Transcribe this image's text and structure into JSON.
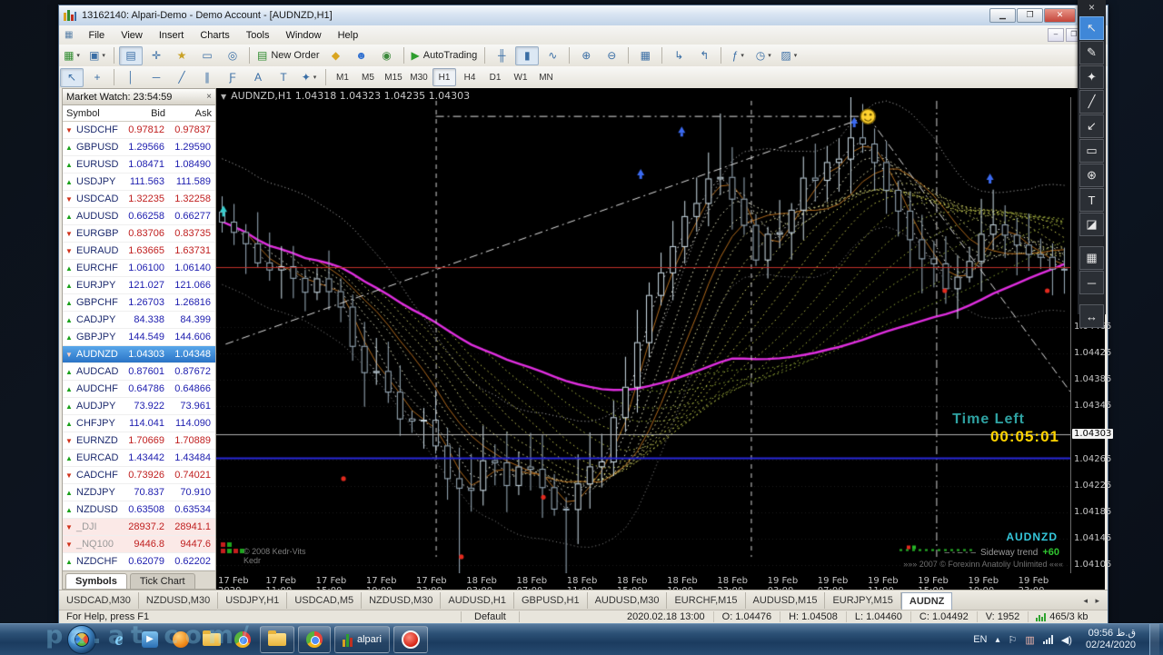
{
  "window": {
    "title": "13162140: Alpari-Demo - Demo Account - [AUDNZD,H1]",
    "menu": [
      "File",
      "View",
      "Insert",
      "Charts",
      "Tools",
      "Window",
      "Help"
    ]
  },
  "toolbar_row1": [
    {
      "name": "new-chart",
      "glyph": "▦",
      "dropdown": true,
      "accent": "#2e8b2e"
    },
    {
      "name": "profiles",
      "glyph": "▣",
      "dropdown": true
    },
    {
      "sep": true
    },
    {
      "name": "market-watch-toggle",
      "glyph": "▤",
      "pressed": true
    },
    {
      "name": "data-window",
      "glyph": "✛"
    },
    {
      "name": "navigator",
      "glyph": "★",
      "accent": "#c9a227"
    },
    {
      "name": "terminal",
      "glyph": "▭"
    },
    {
      "name": "strategy-tester",
      "glyph": "◎"
    },
    {
      "sep": true
    },
    {
      "name": "new-order",
      "glyph": "▤",
      "label": "New Order",
      "accent": "#2e8b2e"
    },
    {
      "name": "mql-editor",
      "glyph": "◆",
      "accent": "#d9a520"
    },
    {
      "name": "community",
      "glyph": "☻",
      "accent": "#2f6fd0"
    },
    {
      "name": "broadcast",
      "glyph": "◉",
      "accent": "#3c8a3c"
    },
    {
      "sep": true
    },
    {
      "name": "autotrading",
      "glyph": "▶",
      "label": "AutoTrading",
      "accent": "#2e9e2e"
    },
    {
      "sep": true
    },
    {
      "name": "bar-chart-mode",
      "glyph": "╫"
    },
    {
      "name": "candlestick-mode",
      "glyph": "▮",
      "pressed": true
    },
    {
      "name": "line-chart-mode",
      "glyph": "∿"
    },
    {
      "sep": true
    },
    {
      "name": "zoom-in",
      "glyph": "⊕"
    },
    {
      "name": "zoom-out",
      "glyph": "⊖"
    },
    {
      "sep": true
    },
    {
      "name": "tile-windows",
      "glyph": "▦"
    },
    {
      "sep": true
    },
    {
      "name": "auto-scroll",
      "glyph": "↳"
    },
    {
      "name": "chart-shift",
      "glyph": "↰"
    },
    {
      "sep": true
    },
    {
      "name": "indicators-list",
      "glyph": "ƒ",
      "dropdown": true
    },
    {
      "name": "periods-list",
      "glyph": "◷",
      "dropdown": true
    },
    {
      "name": "templates",
      "glyph": "▨",
      "dropdown": true
    }
  ],
  "toolbar_row2": [
    {
      "name": "cursor",
      "glyph": "↖",
      "pressed": true
    },
    {
      "name": "crosshair",
      "glyph": "+"
    },
    {
      "sep": true
    },
    {
      "name": "vertical-line",
      "glyph": "│"
    },
    {
      "name": "horizontal-line",
      "glyph": "─"
    },
    {
      "name": "trendline",
      "glyph": "╱"
    },
    {
      "name": "equidistant-channel",
      "glyph": "∥"
    },
    {
      "name": "fibonacci",
      "glyph": "Ƒ"
    },
    {
      "name": "text",
      "glyph": "A"
    },
    {
      "name": "text-label",
      "glyph": "T"
    },
    {
      "name": "arrows-tool",
      "glyph": "✦",
      "dropdown": true
    }
  ],
  "timeframes": {
    "items": [
      "M1",
      "M5",
      "M15",
      "M30",
      "H1",
      "H4",
      "D1",
      "W1",
      "MN"
    ],
    "active": "H1"
  },
  "market_watch": {
    "title": "Market Watch: 23:54:59",
    "columns": [
      "Symbol",
      "Bid",
      "Ask"
    ],
    "rows": [
      {
        "symbol": "USDCHF",
        "bid": "0.97812",
        "ask": "0.97837",
        "dir": "down"
      },
      {
        "symbol": "GBPUSD",
        "bid": "1.29566",
        "ask": "1.29590",
        "dir": "up"
      },
      {
        "symbol": "EURUSD",
        "bid": "1.08471",
        "ask": "1.08490",
        "dir": "up"
      },
      {
        "symbol": "USDJPY",
        "bid": "111.563",
        "ask": "111.589",
        "dir": "up"
      },
      {
        "symbol": "USDCAD",
        "bid": "1.32235",
        "ask": "1.32258",
        "dir": "down"
      },
      {
        "symbol": "AUDUSD",
        "bid": "0.66258",
        "ask": "0.66277",
        "dir": "up"
      },
      {
        "symbol": "EURGBP",
        "bid": "0.83706",
        "ask": "0.83735",
        "dir": "down"
      },
      {
        "symbol": "EURAUD",
        "bid": "1.63665",
        "ask": "1.63731",
        "dir": "down"
      },
      {
        "symbol": "EURCHF",
        "bid": "1.06100",
        "ask": "1.06140",
        "dir": "up"
      },
      {
        "symbol": "EURJPY",
        "bid": "121.027",
        "ask": "121.066",
        "dir": "up"
      },
      {
        "symbol": "GBPCHF",
        "bid": "1.26703",
        "ask": "1.26816",
        "dir": "up"
      },
      {
        "symbol": "CADJPY",
        "bid": "84.338",
        "ask": "84.399",
        "dir": "up"
      },
      {
        "symbol": "GBPJPY",
        "bid": "144.549",
        "ask": "144.606",
        "dir": "up"
      },
      {
        "symbol": "AUDNZD",
        "bid": "1.04303",
        "ask": "1.04348",
        "dir": "down",
        "selected": true
      },
      {
        "symbol": "AUDCAD",
        "bid": "0.87601",
        "ask": "0.87672",
        "dir": "up"
      },
      {
        "symbol": "AUDCHF",
        "bid": "0.64786",
        "ask": "0.64866",
        "dir": "up"
      },
      {
        "symbol": "AUDJPY",
        "bid": "73.922",
        "ask": "73.961",
        "dir": "up"
      },
      {
        "symbol": "CHFJPY",
        "bid": "114.041",
        "ask": "114.090",
        "dir": "up"
      },
      {
        "symbol": "EURNZD",
        "bid": "1.70669",
        "ask": "1.70889",
        "dir": "down"
      },
      {
        "symbol": "EURCAD",
        "bid": "1.43442",
        "ask": "1.43484",
        "dir": "up"
      },
      {
        "symbol": "CADCHF",
        "bid": "0.73926",
        "ask": "0.74021",
        "dir": "down"
      },
      {
        "symbol": "NZDJPY",
        "bid": "70.837",
        "ask": "70.910",
        "dir": "up"
      },
      {
        "symbol": "NZDUSD",
        "bid": "0.63508",
        "ask": "0.63534",
        "dir": "up"
      },
      {
        "symbol": "_DJI",
        "bid": "28937.2",
        "ask": "28941.1",
        "dir": "down",
        "index": true
      },
      {
        "symbol": "_NQ100",
        "bid": "9446.8",
        "ask": "9447.6",
        "dir": "down",
        "index": true
      },
      {
        "symbol": "NZDCHF",
        "bid": "0.62079",
        "ask": "0.62202",
        "dir": "up"
      }
    ],
    "tabs": [
      "Symbols",
      "Tick Chart"
    ],
    "active_tab": "Symbols"
  },
  "chart": {
    "info": "AUDNZD,H1  1.04318 1.04323 1.04235 1.04303",
    "time_left_label": "Time Left",
    "time_left_value": "00:05:01",
    "symbol_badge": "AUDNZD",
    "trend_prefix": "– - – - –",
    "trend_label": "Sideway trend",
    "trend_value": "+60",
    "copyright": "»»»   2007 © Forexinn Anatoliy Unlimited   «««",
    "watermark_line1": "© 2008 Kedr-Vits",
    "watermark_line2": "Kedr",
    "current_price": "1.04303",
    "price_labels": [
      "1.04465",
      "1.04425",
      "1.04385",
      "1.04345",
      "1.04265",
      "1.04225",
      "1.04185",
      "1.04145",
      "1.04105"
    ],
    "date_labels": [
      "17 Feb 2020",
      "17 Feb 11:00",
      "17 Feb 15:00",
      "17 Feb 19:00",
      "17 Feb 23:00",
      "18 Feb 03:00",
      "18 Feb 07:00",
      "18 Feb 11:00",
      "18 Feb 15:00",
      "18 Feb 19:00",
      "18 Feb 23:00",
      "19 Feb 03:00",
      "19 Feb 07:00",
      "19 Feb 11:00",
      "19 Feb 15:00",
      "19 Feb 19:00",
      "19 Feb 23:00"
    ]
  },
  "chart_data": {
    "type": "candlestick",
    "symbol": "AUDNZD",
    "timeframe": "H1",
    "ylim": [
      1.04093,
      1.04812
    ],
    "bars": 72,
    "price_path": [
      [
        0,
        1.0462
      ],
      [
        0.03,
        1.04585
      ],
      [
        0.06,
        1.04555
      ],
      [
        0.09,
        1.04535
      ],
      [
        0.12,
        1.04521
      ],
      [
        0.145,
        1.04504
      ],
      [
        0.16,
        1.04381
      ],
      [
        0.18,
        1.04408
      ],
      [
        0.21,
        1.04333
      ],
      [
        0.24,
        1.04312
      ],
      [
        0.27,
        1.04244
      ],
      [
        0.29,
        1.04196
      ],
      [
        0.31,
        1.04264
      ],
      [
        0.34,
        1.0423
      ],
      [
        0.36,
        1.04264
      ],
      [
        0.39,
        1.04209
      ],
      [
        0.41,
        1.04189
      ],
      [
        0.43,
        1.0423
      ],
      [
        0.455,
        1.04285
      ],
      [
        0.48,
        1.04381
      ],
      [
        0.5,
        1.04477
      ],
      [
        0.53,
        1.04573
      ],
      [
        0.56,
        1.04642
      ],
      [
        0.585,
        1.04703
      ],
      [
        0.61,
        1.04642
      ],
      [
        0.635,
        1.04573
      ],
      [
        0.66,
        1.04614
      ],
      [
        0.69,
        1.04683
      ],
      [
        0.72,
        1.04724
      ],
      [
        0.75,
        1.04751
      ],
      [
        0.77,
        1.04717
      ],
      [
        0.8,
        1.04649
      ],
      [
        0.83,
        1.04573
      ],
      [
        0.86,
        1.04532
      ],
      [
        0.885,
        1.04559
      ],
      [
        0.91,
        1.04635
      ],
      [
        0.94,
        1.04594
      ],
      [
        0.97,
        1.04559
      ],
      [
        1,
        1.04566
      ]
    ],
    "ribbon_periods": [
      2,
      4,
      6,
      8,
      10,
      12,
      14,
      16,
      18,
      20,
      23,
      26,
      29,
      32,
      36,
      40
    ],
    "ribbon_colors": [
      "#f2f2f2",
      "#e3e35a",
      "#8ca832"
    ],
    "envelope_period": 8,
    "envelope_offset": 0.00095,
    "magenta_period": 44,
    "magenta_color": "#e02ee0",
    "orange_periods": [
      3,
      9
    ],
    "orange_color": "#b06a1c",
    "candle_up_color": "#cfe0ea",
    "candle_down_color": "#9fb2c0",
    "hlines": [
      {
        "price": 1.04555,
        "color": "#c03028",
        "width": 1
      },
      {
        "price": 1.04303,
        "color": "#b0b0b0",
        "width": 1
      },
      {
        "price": 1.04267,
        "color": "#2828d8",
        "width": 2
      }
    ],
    "vlines": [
      {
        "t": 0.257,
        "style": "dash"
      },
      {
        "t": 0.626,
        "style": "dash"
      },
      {
        "t": 0.843,
        "style": "dashdot"
      }
    ],
    "trend_lines": [
      {
        "t1": 0.011,
        "p1": 1.04439,
        "t2": 0.763,
        "p2": 1.04783
      },
      {
        "t1": 0.763,
        "p1": 1.04783,
        "t2": 1.0,
        "p2": 1.04367
      },
      {
        "t1": 0.257,
        "p1": 1.04783,
        "t2": 0.763,
        "p2": 1.04783
      }
    ],
    "smiley": {
      "t": 0.763,
      "p": 1.04783,
      "color": "#ffd22e"
    },
    "buy_arrows": [
      {
        "t": 0.497,
        "p": 1.0469
      },
      {
        "t": 0.545,
        "p": 1.04754
      },
      {
        "t": 0.747,
        "p": 1.04768
      },
      {
        "t": 0.906,
        "p": 1.04683
      }
    ],
    "sell_dots": [
      {
        "t": 0.149,
        "p": 1.04244
      },
      {
        "t": 0.287,
        "p": 1.04126
      },
      {
        "t": 0.383,
        "p": 1.04216
      },
      {
        "t": 0.853,
        "p": 1.04528
      },
      {
        "t": 0.973,
        "p": 1.04528
      }
    ],
    "cyan_arrow": {
      "t": 0.0085,
      "p": 1.0464
    },
    "wick_extensions": [
      {
        "i": 20,
        "low": 0.0018
      },
      {
        "i": 29,
        "low": 0.0012
      },
      {
        "i": 42,
        "high": 0.0008
      },
      {
        "i": 53,
        "high": 0.0006
      }
    ],
    "corner_legend": [
      [
        "#c41e1e",
        "#1ea51e"
      ],
      [
        "#c41e1e",
        "#1ea51e",
        "#c41e1e",
        "#1ea51e"
      ]
    ],
    "bottom_dots": {
      "t0": 0.8,
      "t1": 0.885,
      "price": 1.04128,
      "color": "#28b828"
    }
  },
  "bottom_tabs": {
    "items": [
      "USDCAD,M30",
      "NZDUSD,M30",
      "USDJPY,H1",
      "USDCAD,M5",
      "NZDUSD,M30",
      "AUDUSD,H1",
      "GBPUSD,H1",
      "AUDUSD,M30",
      "EURCHF,M15",
      "AUDUSD,M15",
      "EURJPY,M15"
    ],
    "active": "AUDNZ",
    "arrows": "◂ ▸"
  },
  "status_bar": {
    "help": "For Help, press F1",
    "profile": "Default",
    "segments": [
      "2020.02.18 13:00",
      "O: 1.04476",
      "H: 1.04508",
      "L: 1.04460",
      "C: 1.04492",
      "V: 1952"
    ],
    "traffic": "465/3 kb"
  },
  "annotation_toolbar": {
    "close": "×",
    "tools": [
      {
        "name": "cursor",
        "glyph": "↖",
        "active": true
      },
      {
        "name": "pencil",
        "glyph": "✎"
      },
      {
        "name": "marker",
        "glyph": "✦"
      },
      {
        "name": "line",
        "glyph": "╱"
      },
      {
        "name": "arrow",
        "glyph": "↙"
      },
      {
        "name": "rectangle",
        "glyph": "▭"
      },
      {
        "name": "steps",
        "glyph": "⊛"
      },
      {
        "name": "text",
        "glyph": "T"
      },
      {
        "name": "eraser",
        "glyph": "◪"
      },
      {
        "gap": true
      },
      {
        "name": "pixelate",
        "glyph": "▦"
      },
      {
        "name": "minimize",
        "glyph": "─"
      },
      {
        "gap": true
      },
      {
        "name": "expand",
        "glyph": "↔"
      }
    ]
  },
  "taskbar": {
    "lang": "EN",
    "app_label": "alpari",
    "clock_time": "09:56 ق.ظ",
    "clock_date": "02/24/2020"
  },
  "watermark": "pa.at   com/"
}
